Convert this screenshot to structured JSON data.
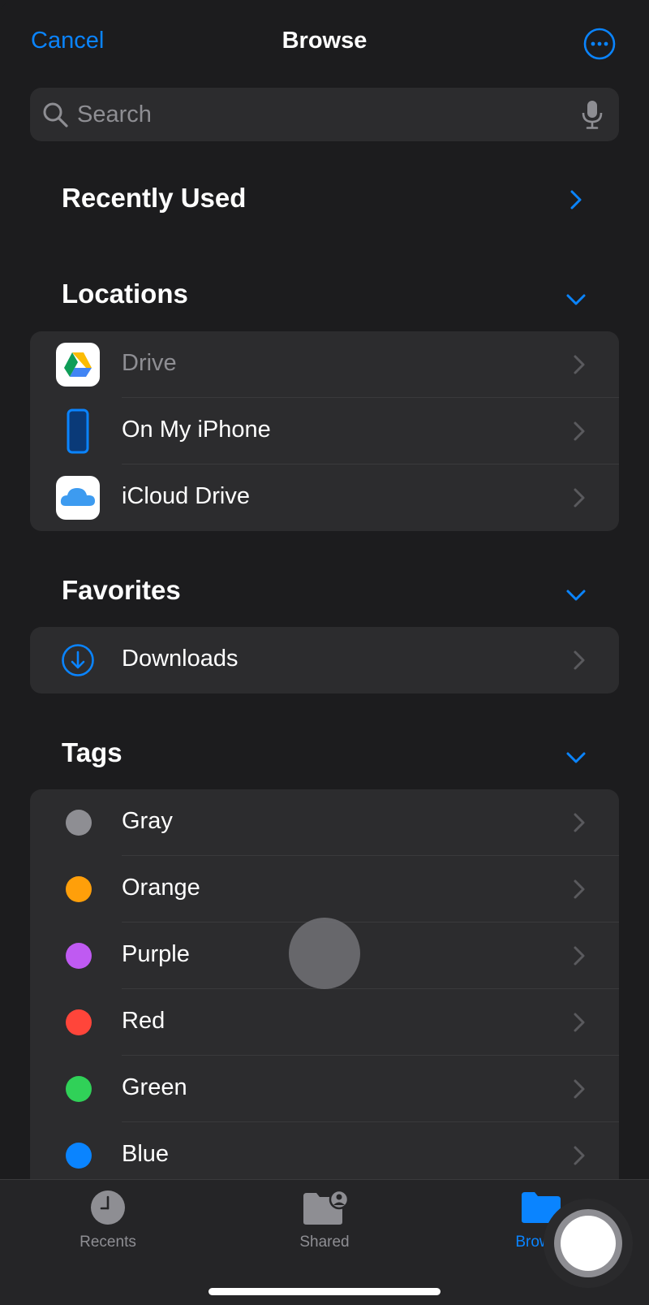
{
  "nav": {
    "cancel_label": "Cancel",
    "title": "Browse",
    "more_icon": "ellipsis-circle-icon"
  },
  "search": {
    "placeholder": "Search",
    "icon": "search-icon",
    "mic_icon": "microphone-icon"
  },
  "sections": {
    "recently_used": {
      "title": "Recently Used"
    },
    "locations": {
      "title": "Locations",
      "items": [
        {
          "label": "Drive",
          "icon": "google-drive-icon",
          "dimmed": true
        },
        {
          "label": "On My iPhone",
          "icon": "iphone-icon"
        },
        {
          "label": "iCloud Drive",
          "icon": "icloud-icon"
        }
      ]
    },
    "favorites": {
      "title": "Favorites",
      "items": [
        {
          "label": "Downloads",
          "icon": "download-circle-icon"
        }
      ]
    },
    "tags": {
      "title": "Tags",
      "items": [
        {
          "label": "Gray",
          "color": "#8e8e93"
        },
        {
          "label": "Orange",
          "color": "#ff9f0a"
        },
        {
          "label": "Purple",
          "color": "#bf5af2"
        },
        {
          "label": "Red",
          "color": "#ff453a"
        },
        {
          "label": "Green",
          "color": "#30d158"
        },
        {
          "label": "Blue",
          "color": "#0a84ff"
        }
      ]
    }
  },
  "tabbar": {
    "tabs": [
      {
        "label": "Recents",
        "icon": "clock-icon",
        "active": false
      },
      {
        "label": "Shared",
        "icon": "shared-folder-icon",
        "active": false
      },
      {
        "label": "Browse",
        "icon": "folder-icon",
        "active": true
      }
    ]
  },
  "colors": {
    "accent": "#0a84ff",
    "background": "#1c1c1e",
    "group": "#2c2c2e"
  }
}
